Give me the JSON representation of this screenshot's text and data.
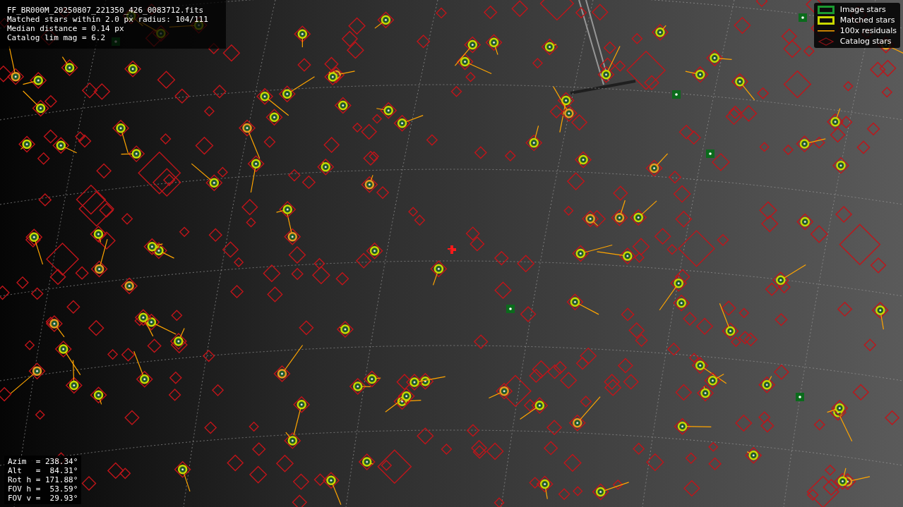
{
  "info": [
    "FF_BR000M_20250807_221350_426_0083712.fits",
    "Matched stars within 2.0 px radius: 104/111",
    "Median distance = 0.14 px",
    "Catalog lim mag = 6.2"
  ],
  "legend": [
    {
      "kind": "image",
      "label": "Image stars"
    },
    {
      "kind": "matched",
      "label": "Matched stars"
    },
    {
      "kind": "residual",
      "label": "100x residuals"
    },
    {
      "kind": "catalog",
      "label": "Catalog stars"
    }
  ],
  "pointing": [
    "Azim  = 238.34°",
    "Alt   =  84.31°",
    "Rot h = 171.88°",
    "FOV h =  53.59°",
    "FOV v =  29.93°"
  ]
}
